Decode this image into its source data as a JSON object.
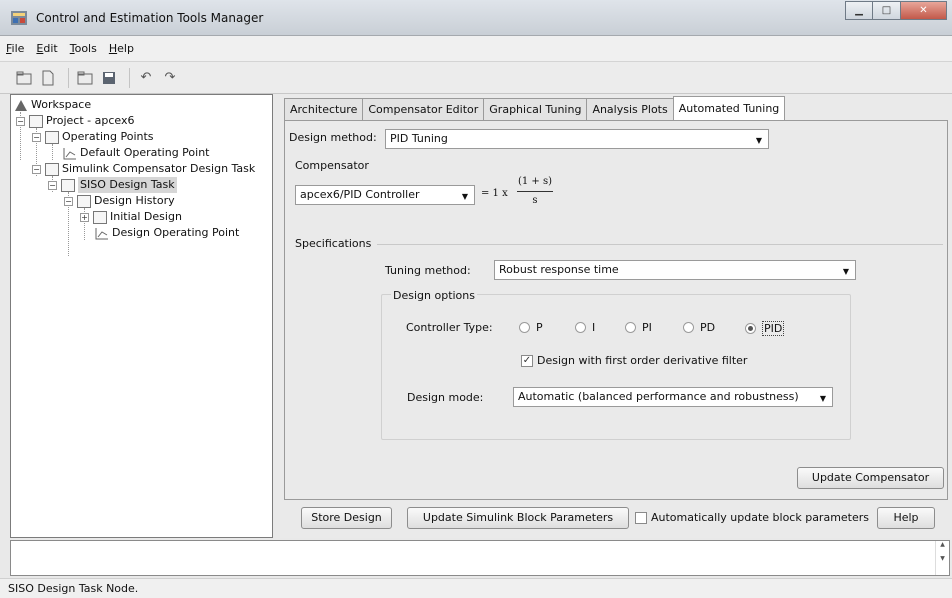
{
  "window": {
    "title": "Control and Estimation Tools Manager",
    "minimize_icon": "minimize-icon",
    "maximize_icon": "maximize-icon",
    "close_icon": "close-icon"
  },
  "menu": [
    "File",
    "Edit",
    "Tools",
    "Help"
  ],
  "toolbar": {
    "icons": [
      "new-icon",
      "open-icon",
      "close-project-icon",
      "save-icon",
      "undo-icon",
      "redo-icon"
    ]
  },
  "tree": {
    "workspace": "Workspace",
    "project": "Project - apcex6",
    "operating_points": "Operating Points",
    "default_op": "Default Operating Point",
    "simulink_task": "Simulink Compensator Design Task",
    "siso_task": "SISO Design Task",
    "design_history": "Design History",
    "initial_design": "Initial Design",
    "design_op": "Design Operating Point"
  },
  "tabs": [
    "Architecture",
    "Compensator Editor",
    "Graphical Tuning",
    "Analysis Plots",
    "Automated Tuning"
  ],
  "active_tab": 4,
  "design_method": {
    "label": "Design method:",
    "value": "PID Tuning"
  },
  "compensator": {
    "group_label": "Compensator",
    "value": "apcex6/PID Controller",
    "formula_prefix": "= 1 x",
    "numerator": "(1 + s)",
    "denominator": "s"
  },
  "specifications": {
    "group_label": "Specifications",
    "tuning_method_label": "Tuning method:",
    "tuning_method_value": "Robust response time",
    "design_options_label": "Design options",
    "controller_type_label": "Controller Type:",
    "controller_types": [
      "P",
      "I",
      "PI",
      "PD",
      "PID"
    ],
    "selected_type": 4,
    "derivative_filter_label": "Design with first order derivative filter",
    "derivative_filter_checked": true,
    "design_mode_label": "Design mode:",
    "design_mode_value": "Automatic (balanced performance and robustness)"
  },
  "buttons": {
    "update_compensator": "Update Compensator",
    "store_design": "Store Design",
    "update_simulink": "Update Simulink Block Parameters",
    "auto_update_label": "Automatically update block parameters",
    "help": "Help"
  },
  "status": "SISO Design Task Node."
}
